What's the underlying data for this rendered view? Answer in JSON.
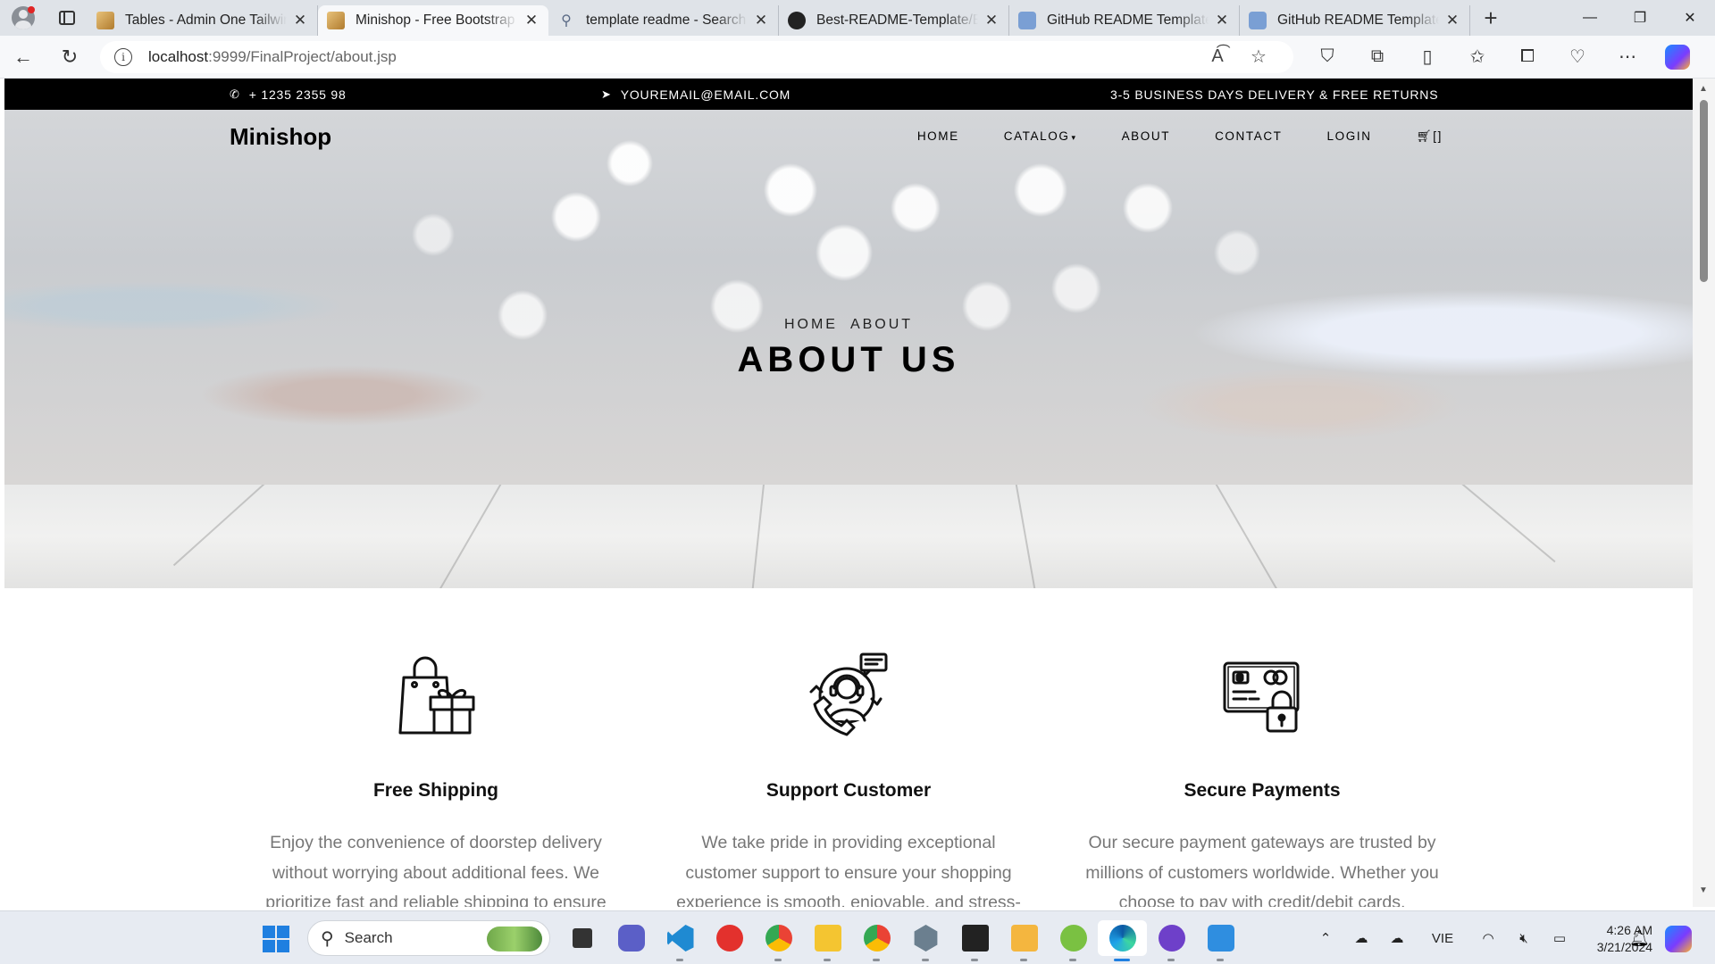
{
  "browser": {
    "tabs": [
      {
        "title": "Tables - Admin One Tailwind",
        "favicon": "minishop-favicon",
        "active": false
      },
      {
        "title": "Minishop - Free Bootstrap",
        "favicon": "minishop-favicon",
        "active": true
      },
      {
        "title": "template readme - Search",
        "favicon": "search-icon",
        "active": false
      },
      {
        "title": "Best-README-Template/BLOB",
        "favicon": "github-icon",
        "active": false
      },
      {
        "title": "GitHub README Templates",
        "favicon": "github-icon",
        "active": false
      },
      {
        "title": "GitHub README Templates",
        "favicon": "github-icon",
        "active": false
      }
    ],
    "url_host": "localhost",
    "url_path": ":9999/FinalProject/about.jsp"
  },
  "site": {
    "topbar": {
      "phone": "+ 1235 2355 98",
      "email": "YOUREMAIL@EMAIL.COM",
      "delivery": "3-5 BUSINESS DAYS DELIVERY & FREE RETURNS"
    },
    "brand": "Minishop",
    "menu": {
      "home": "HOME",
      "catalog": "CATALOG",
      "about": "ABOUT",
      "contact": "CONTACT",
      "login": "LOGIN",
      "cart": "[]"
    },
    "breadcrumb": {
      "home": "HOME",
      "current": "ABOUT"
    },
    "hero_title": "ABOUT US",
    "features": [
      {
        "icon": "shopping-bag-gift-icon",
        "title": "Free Shipping",
        "text": "Enjoy the convenience of doorstep delivery without worrying about additional fees. We prioritize fast and reliable shipping to ensure"
      },
      {
        "icon": "customer-support-icon",
        "title": "Support Customer",
        "text": "We take pride in providing exceptional customer support to ensure your shopping experience is smooth, enjoyable, and stress-"
      },
      {
        "icon": "secure-card-icon",
        "title": "Secure Payments",
        "text": "Our secure payment gateways are trusted by millions of customers worldwide. Whether you choose to pay with credit/debit cards,"
      }
    ]
  },
  "taskbar": {
    "search_label": "Search",
    "language": "VIE",
    "time": "4:26 AM",
    "date": "3/21/2024"
  }
}
